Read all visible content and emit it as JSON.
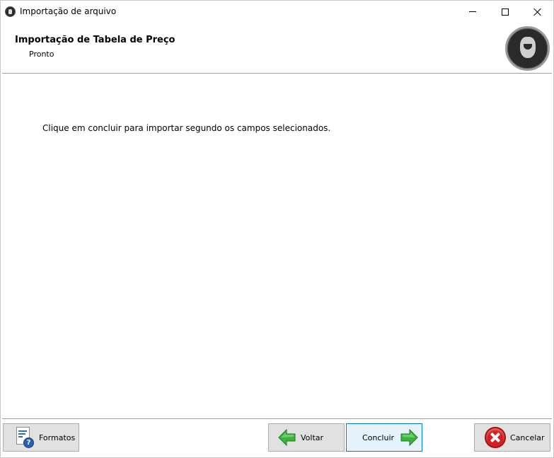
{
  "window": {
    "title": "Importação de arquivo",
    "icon": "app-logo-icon"
  },
  "window_controls": {
    "minimize_icon": "minimize-icon",
    "maximize_icon": "maximize-icon",
    "close_icon": "close-icon"
  },
  "header": {
    "title": "Importação de Tabela de Preço",
    "subtitle": "Pronto",
    "logo_icon": "brand-logo-icon"
  },
  "content": {
    "message": "Clique em concluir para importar segundo os campos selecionados."
  },
  "footer": {
    "formatos": {
      "label": "Formatos",
      "icon": "document-help-icon"
    },
    "voltar": {
      "label": "Voltar",
      "icon": "arrow-left-icon"
    },
    "concluir": {
      "label": "Concluir",
      "icon": "arrow-right-icon"
    },
    "cancelar": {
      "label": "Cancelar",
      "icon": "cancel-icon"
    }
  },
  "colors": {
    "arrow_green": "#3cb43c",
    "cancel_red": "#d42020",
    "focus_border": "#0078d7"
  }
}
